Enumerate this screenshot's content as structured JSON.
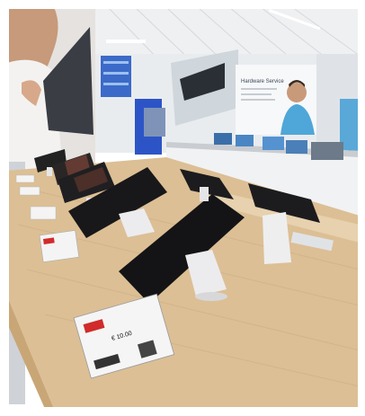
{
  "scene": {
    "description_sign_text": "Hardware Service",
    "price_tag_text": "€ 10.00",
    "colors": {
      "wood_counter": "#d9b98c",
      "ceiling": "#f2f3f4",
      "tablet_screen": "#1a1a1c",
      "stand": "#e8e8ea",
      "tag_accent": "#d12b2b",
      "blue_panel": "#2d54c7"
    }
  }
}
